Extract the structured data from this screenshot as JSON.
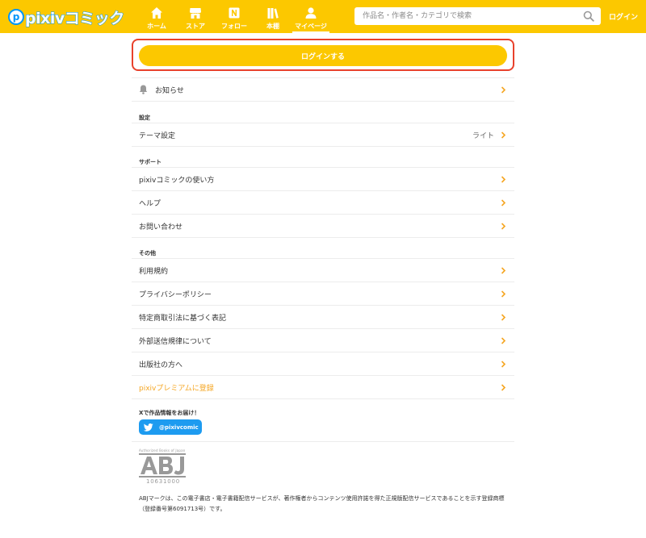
{
  "header": {
    "logo_mark": "p",
    "logo_text": "pixiv",
    "logo_text_comic": "コミック",
    "nav": [
      {
        "label": "ホーム",
        "icon": "home-icon"
      },
      {
        "label": "ストア",
        "icon": "store-icon"
      },
      {
        "label": "フォロー",
        "icon": "follow-icon"
      },
      {
        "label": "本棚",
        "icon": "bookshelf-icon"
      },
      {
        "label": "マイページ",
        "icon": "user-icon",
        "active": true
      }
    ],
    "search_placeholder": "作品名・作者名・カテゴリで検索",
    "login": "ログイン"
  },
  "main": {
    "login_button": "ログインする",
    "notice": "お知らせ",
    "sections": {
      "settings": "設定",
      "support": "サポート",
      "other": "その他"
    },
    "theme": {
      "label": "テーマ設定",
      "value": "ライト"
    },
    "support_items": [
      "pixivコミックの使い方",
      "ヘルプ",
      "お問い合わせ"
    ],
    "other_items": [
      "利用規約",
      "プライバシーポリシー",
      "特定商取引法に基づく表記",
      "外部送信規律について",
      "出版社の方へ"
    ],
    "premium": "pixivプレミアムに登録",
    "x_title": "Xで作品情報をお届け！",
    "twitter_handle": "@pixivcomic",
    "abj_small": "Authorized Books of Japan",
    "abj_number": "10631000",
    "abj_text": "ABJマークは、この電子書店・電子書籍配信サービスが、著作権者からコンテンツ使用許諾を得た正規版配信サービスであることを示す登録商標（登録番号第6091713号）です。"
  },
  "colors": {
    "header_bg": "#fcc800",
    "accent_red": "#e8412c",
    "premium": "#f5a623",
    "twitter": "#1d9bf0"
  }
}
